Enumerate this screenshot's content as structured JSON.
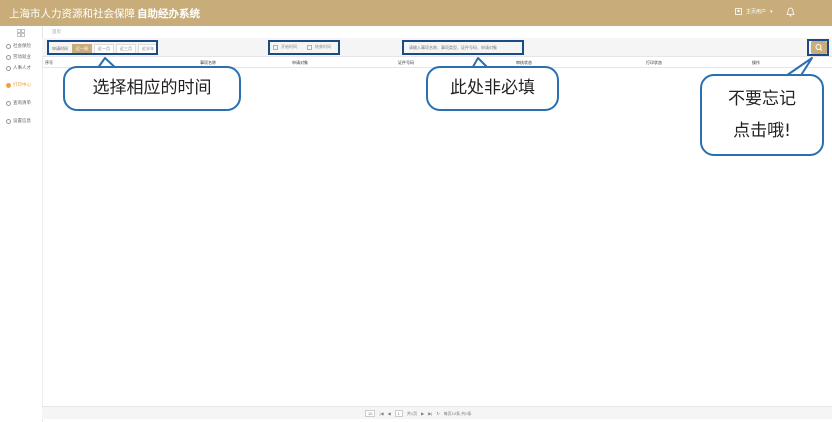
{
  "header": {
    "org_name": "上海市人力资源和社会保障",
    "system_name": "自助经办系统",
    "user_label": "主页用户",
    "brand_color": "#c8ad7a"
  },
  "sidebar": {
    "items": [
      {
        "label": "社会保险",
        "icon": "shield-icon"
      },
      {
        "label": "劳动就业",
        "icon": "person-icon"
      },
      {
        "label": "人事人才",
        "icon": "people-icon"
      },
      {
        "label": "打印中心",
        "icon": "printer-icon",
        "active": true
      },
      {
        "label": "查询清单",
        "icon": "list-icon"
      },
      {
        "label": "设置信息",
        "icon": "gear-icon"
      }
    ]
  },
  "breadcrumb": "首页",
  "filter": {
    "label": "申请时间",
    "tabs": [
      "近一周",
      "近一月",
      "近三月",
      "近半年"
    ],
    "start_date": "开始时间",
    "end_date": "结束时间",
    "search_placeholder": "请输入事项名称、事项类型、证件号码、申请对象"
  },
  "table": {
    "headers": [
      "序号",
      "事项名称",
      "申请对象",
      "证件号码",
      "审核状态",
      "打印状态",
      "操作"
    ]
  },
  "pager": {
    "per_page": "10",
    "page": "1",
    "total_pages": "共1页",
    "summary": "每页10条,共0条"
  },
  "annotations": {
    "select_time": "选择相应的时间",
    "optional": "此处非必填",
    "dont_forget": "不要忘记\n点击哦!"
  }
}
